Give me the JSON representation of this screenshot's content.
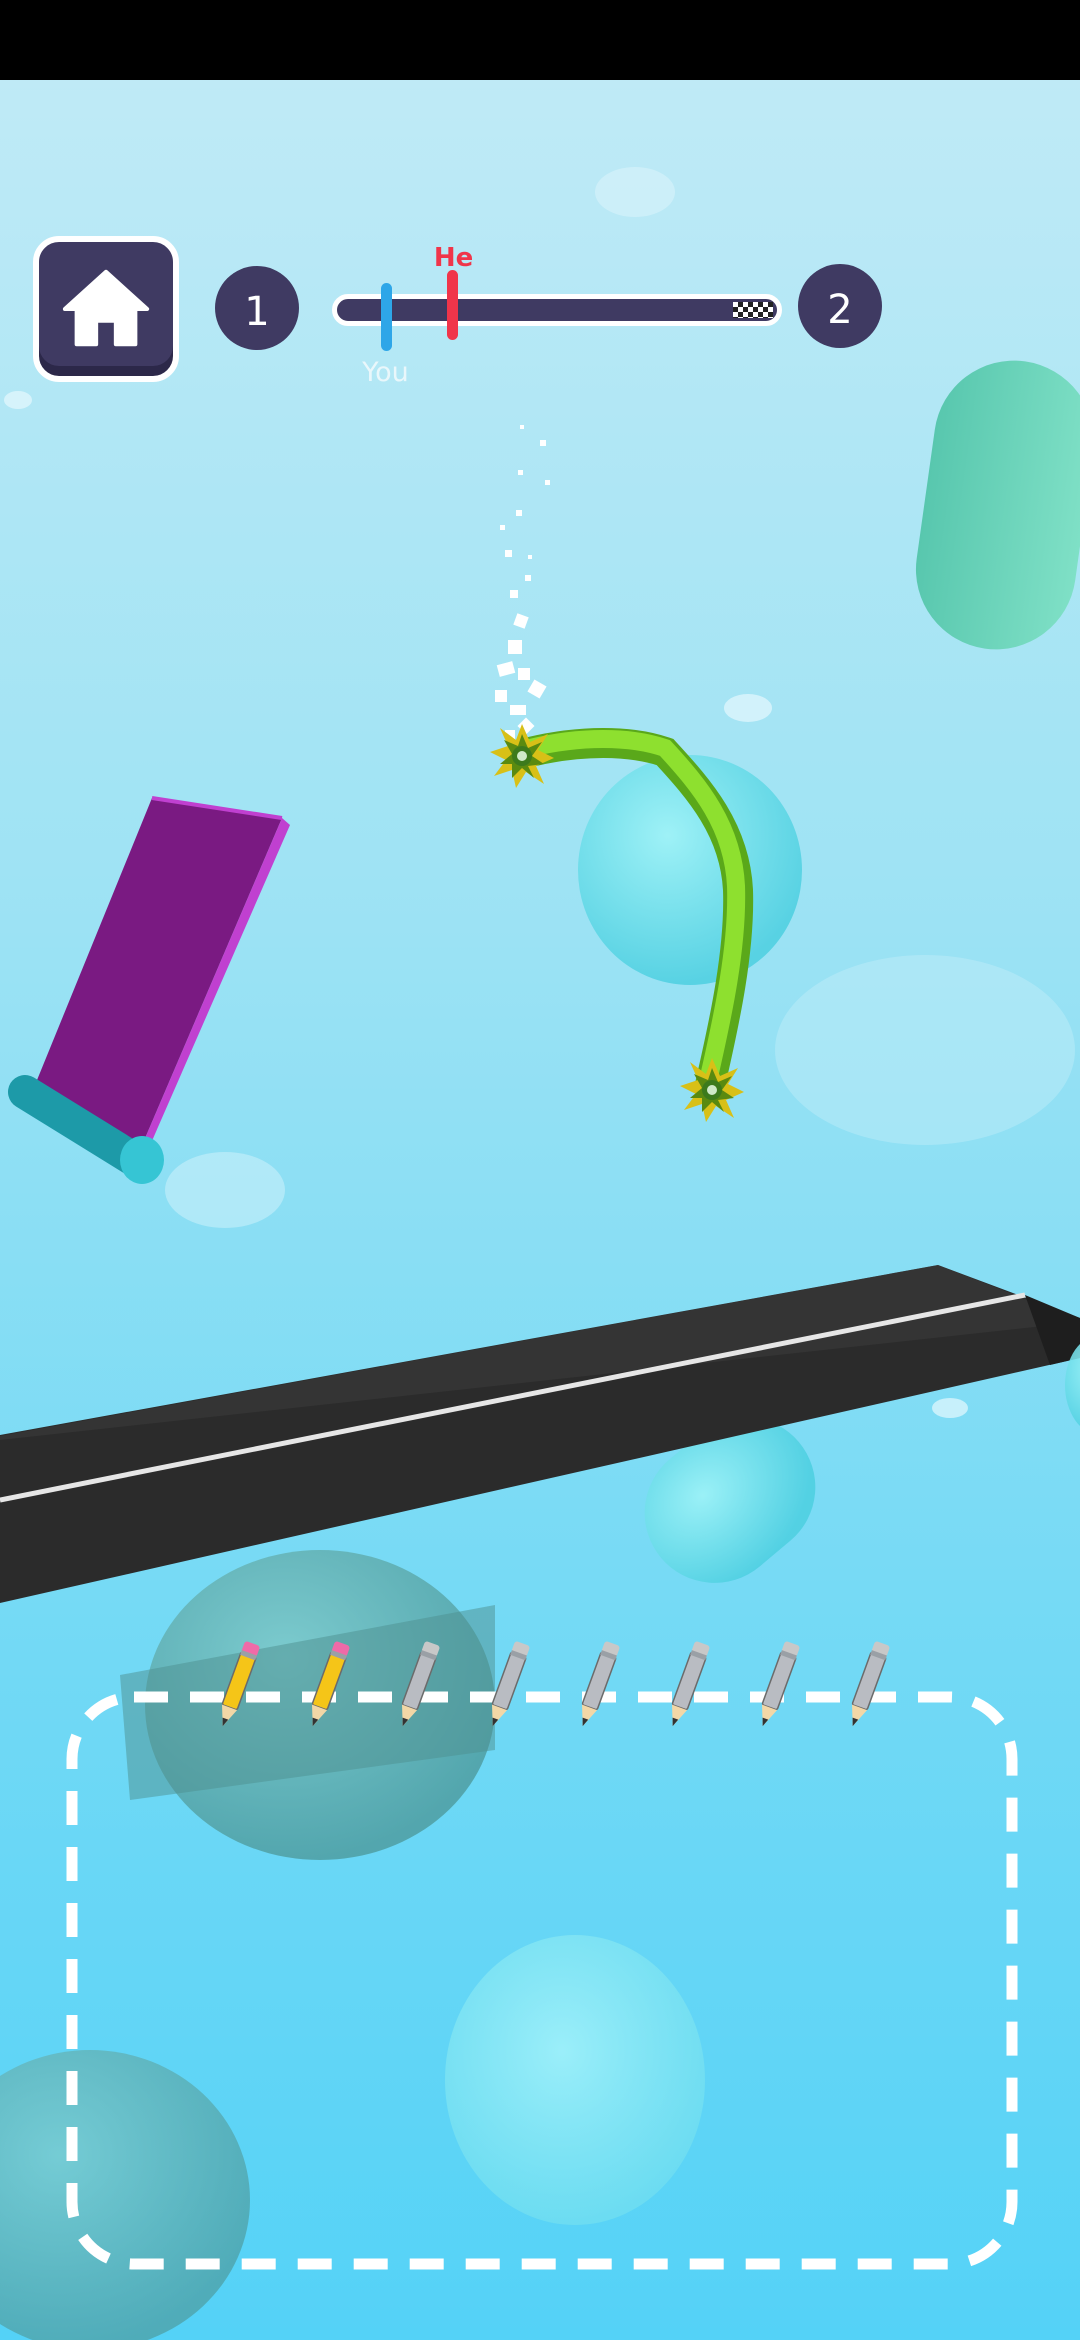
{
  "hud": {
    "level_current": "1",
    "level_next": "2",
    "you_label": "You",
    "he_label": "He",
    "progress_you": 0.11,
    "progress_he": 0.26
  },
  "icons": {
    "home": "home-icon",
    "finish": "checkered-flag-icon",
    "pencil": "pencil-icon"
  },
  "pencils": {
    "total": 8,
    "used": 2,
    "used_color": "#f5c518",
    "unused_color": "#b9bcc2"
  },
  "colors": {
    "hud_dark": "#3f3a62",
    "you": "#2ea6e8",
    "he": "#f0354a",
    "drawn_line": "#7ed321",
    "road": "#2b2b2b"
  }
}
